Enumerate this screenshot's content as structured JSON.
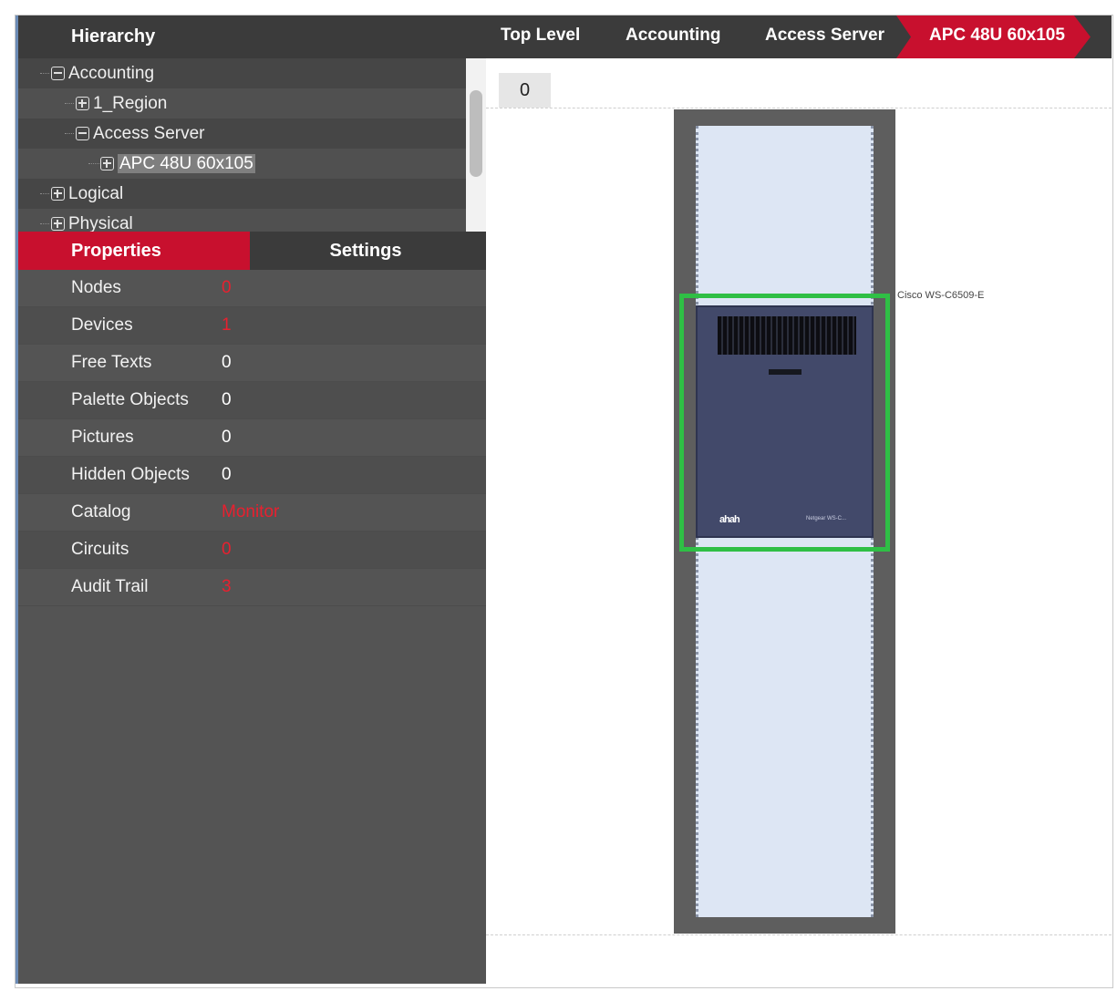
{
  "hierarchy": {
    "title": "Hierarchy",
    "tree": [
      {
        "label": "Accounting",
        "toggle": "collapse"
      },
      {
        "label": "1_Region",
        "toggle": "expand"
      },
      {
        "label": "Access Server",
        "toggle": "collapse"
      },
      {
        "label": "APC 48U 60x105",
        "toggle": "expand",
        "selected": true
      },
      {
        "label": "Logical",
        "toggle": "expand"
      },
      {
        "label": "Physical",
        "toggle": "expand"
      }
    ]
  },
  "tabs": {
    "properties": "Properties",
    "settings": "Settings",
    "active": "Properties"
  },
  "properties": [
    {
      "key": "Nodes",
      "value": "0",
      "link": true
    },
    {
      "key": "Devices",
      "value": "1",
      "link": true
    },
    {
      "key": "Free Texts",
      "value": "0",
      "link": false
    },
    {
      "key": "Palette Objects",
      "value": "0",
      "link": false
    },
    {
      "key": "Pictures",
      "value": "0",
      "link": false
    },
    {
      "key": "Hidden Objects",
      "value": "0",
      "link": false
    },
    {
      "key": "Catalog",
      "value": "Monitor",
      "link": true
    },
    {
      "key": "Circuits",
      "value": "0",
      "link": true
    },
    {
      "key": "Audit Trail",
      "value": "3",
      "link": true
    }
  ],
  "breadcrumb": [
    "Top Level",
    "Accounting",
    "Access Server",
    "APC 48U 60x105"
  ],
  "canvas": {
    "level_indicator": "0",
    "device_label": "Cisco WS-C6509-E",
    "device_logo": "ahah",
    "device_model": "Netgear WS-C..."
  },
  "colors": {
    "accent": "#c8102e",
    "selection": "#2fbf45",
    "panel_bg": "#545454",
    "header_bg": "#3b3b3b"
  }
}
